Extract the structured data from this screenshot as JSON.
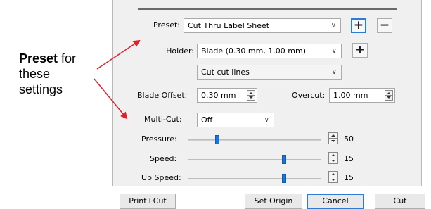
{
  "annotation": {
    "bold": "Preset",
    "rest1": " for",
    "line2": "these",
    "line3": "settings"
  },
  "preset": {
    "label": "Preset:",
    "value": "Cut Thru Label Sheet",
    "add_symbol": "+",
    "remove_symbol": "−"
  },
  "holder": {
    "label": "Holder:",
    "value": "Blade (0.30 mm, 1.00 mm)",
    "add_symbol": "+"
  },
  "cut_mode": {
    "value": "Cut cut lines"
  },
  "blade_offset": {
    "label": "Blade Offset:",
    "value": "0.30 mm"
  },
  "overcut": {
    "label": "Overcut:",
    "value": "1.00 mm"
  },
  "multi_cut": {
    "label": "Multi-Cut:",
    "value": "Off"
  },
  "sliders": {
    "pressure": {
      "label": "Pressure:",
      "value": "50",
      "level": 0.22
    },
    "speed": {
      "label": "Speed:",
      "value": "15",
      "level": 0.72
    },
    "up_speed": {
      "label": "Up Speed:",
      "value": "15",
      "level": 0.72
    }
  },
  "buttons": {
    "print_cut": "Print+Cut",
    "set_origin": "Set Origin",
    "cancel": "Cancel",
    "cut": "Cut"
  },
  "icons": {
    "dropdown": "chevron-down-icon",
    "spinner": "spinner-icon",
    "arrow": "arrow-icon"
  },
  "colors": {
    "accent": "#2f7ad6",
    "thumb": "#1e73d6",
    "arrow": "#e0202a"
  }
}
